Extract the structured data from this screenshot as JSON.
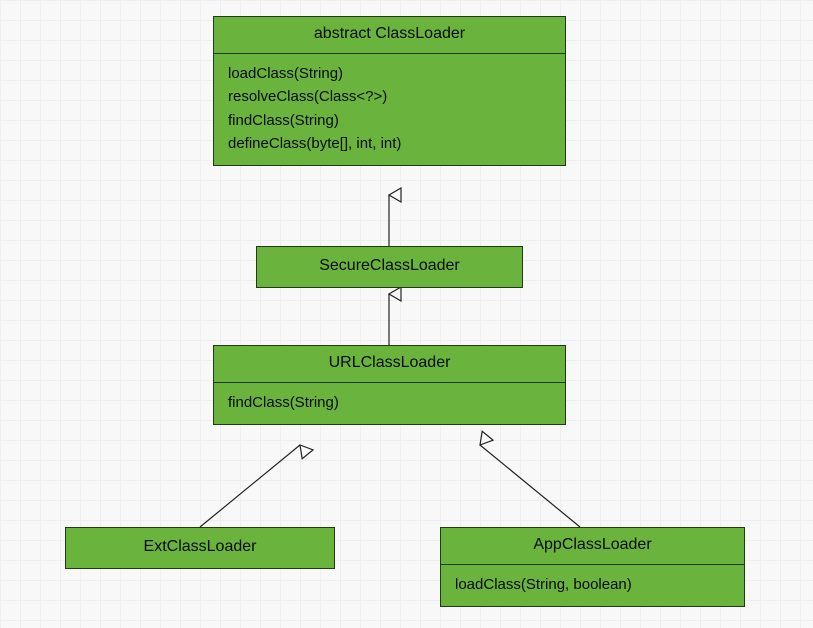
{
  "classes": {
    "classloader": {
      "title": "abstract ClassLoader",
      "m0": "loadClass(String)",
      "m1": "resolveClass(Class<?>)",
      "m2": "findClass(String)",
      "m3": "defineClass(byte[], int, int)"
    },
    "secure": {
      "title": "SecureClassLoader"
    },
    "url": {
      "title": "URLClassLoader",
      "m0": "findClass(String)"
    },
    "ext": {
      "title": "ExtClassLoader"
    },
    "app": {
      "title": "AppClassLoader",
      "m0": "loadClass(String, boolean)"
    }
  },
  "colors": {
    "fill": "#6ab43e",
    "border": "#1f3b13",
    "grid": "#eeeeee",
    "bg": "#f8f8f8"
  }
}
